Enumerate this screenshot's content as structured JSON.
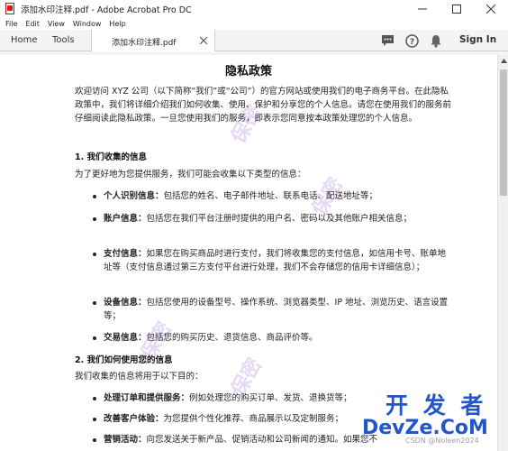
{
  "window": {
    "title": "添加水印注释.pdf - Adobe Acrobat Pro DC"
  },
  "menu": {
    "items": [
      "File",
      "Edit",
      "View",
      "Window",
      "Help"
    ]
  },
  "tabs": {
    "home": "Home",
    "tools": "Tools",
    "document": "添加水印注释.pdf",
    "signin": "Sign In"
  },
  "doc": {
    "title": "隐私政策",
    "intro": "欢迎访问 XYZ 公司（以下简称“我们”或“公司”）的官方网站或使用我们的电子商务平台。在此隐私政策中，我们将详细介绍我们如何收集、使用、保护和分享您的个人信息。请您在使用我们的服务前仔细阅读此隐私政策。一旦您使用我们的服务，即表示您同意按本政策处理您的个人信息。",
    "section1": {
      "heading": "1. 我们收集的信息",
      "lead": "为了更好地为您提供服务，我们可能会收集以下类型的信息：",
      "items": [
        {
          "label": "个人识别信息：",
          "text": "包括您的姓名、电子邮件地址、联系电话、配送地址等；"
        },
        {
          "label": "账户信息：",
          "text": "包括您在我们平台注册时提供的用户名、密码以及其他账户相关信息；"
        },
        {
          "label": "支付信息：",
          "text": "如果您在购买商品时进行支付，我们将收集您的支付信息，如信用卡号、账单地址等（支付信息通过第三方支付平台进行处理，我们不会存储您的信用卡详细信息）；"
        },
        {
          "label": "设备信息：",
          "text": "包括您使用的设备型号、操作系统、浏览器类型、IP 地址、浏览历史、语言设置等；"
        },
        {
          "label": "交易信息：",
          "text": "包括您的购买历史、退货信息、商品评价等。"
        }
      ]
    },
    "section2": {
      "heading": "2. 我们如何使用您的信息",
      "lead": "我们收集的信息将用于以下目的：",
      "items": [
        {
          "label": "处理订单和提供服务：",
          "text": "例如处理您的购买订单、发货、退换货等；"
        },
        {
          "label": "改善客户体验：",
          "text": "为您提供个性化推荐、商品展示以及定制服务；"
        },
        {
          "label": "营销活动：",
          "text": "向您发送关于新产品、促销活动和公司新闻的通知。如果您不"
        }
      ]
    },
    "watermarks": [
      "保密",
      "保密",
      "保密",
      "保密"
    ],
    "overlay": {
      "cn": "开 发 者",
      "en": "DevZe.CoM",
      "csdn": "CSDN @Noleen2024"
    }
  },
  "colors": {
    "accent": "#2356c9",
    "watermark": "#8c50c8",
    "acrobat_red": "#d81e05"
  }
}
